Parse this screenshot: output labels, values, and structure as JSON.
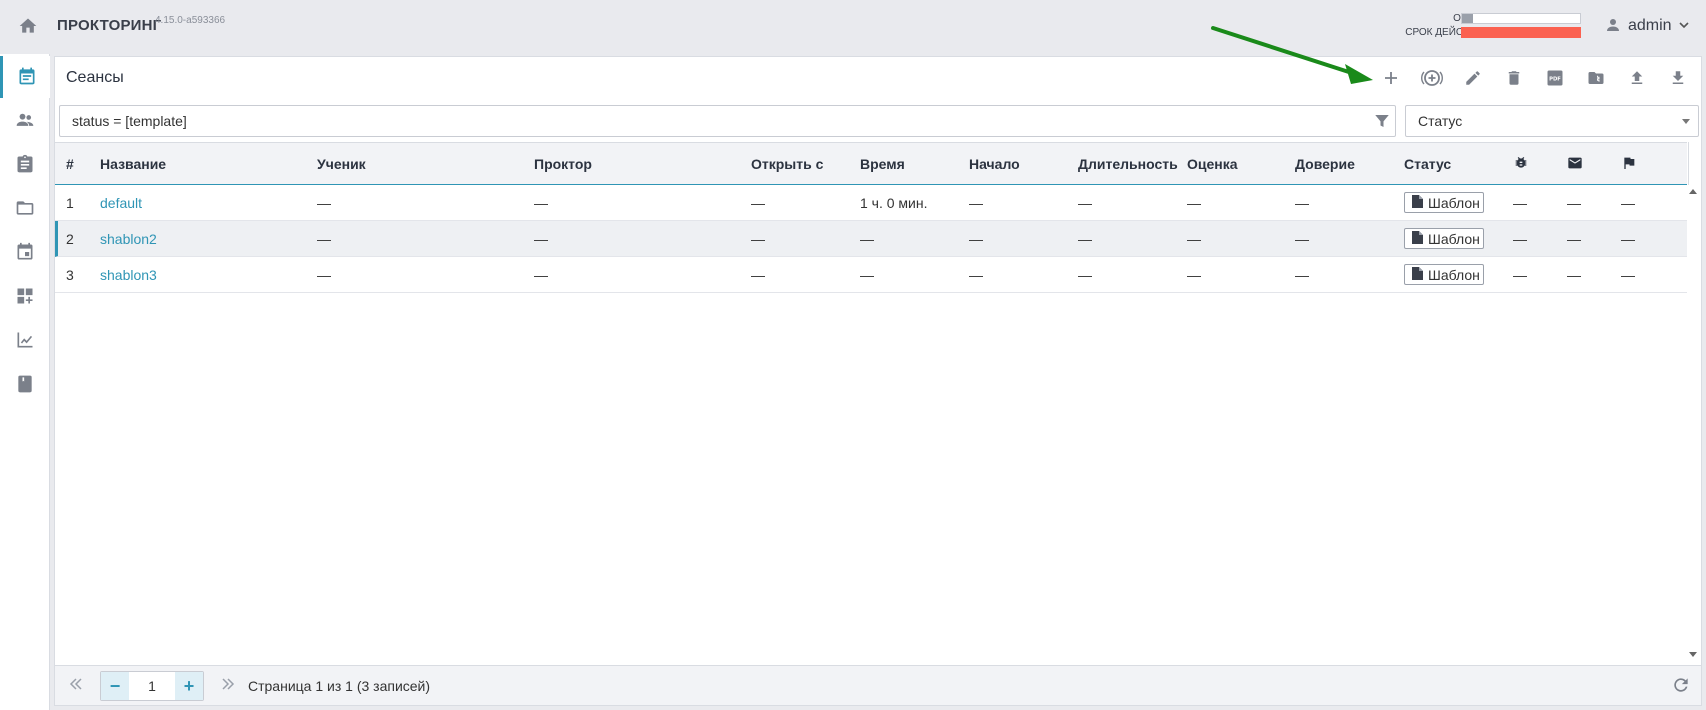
{
  "header": {
    "app_title": "ПРОКТОРИНГ",
    "app_version": "4.15.0-a593366",
    "quota_label": "ОБЪЕМ",
    "expiry_label": "СРОК ДЕЙСТВИЯ",
    "quota_fill": 0.09,
    "expiry_fill": 1.0,
    "user_name": "admin"
  },
  "sidebar": {
    "items": [
      {
        "icon": "calendar-icon",
        "active": true
      },
      {
        "icon": "users-icon",
        "active": false
      },
      {
        "icon": "clipboard-icon",
        "active": false
      },
      {
        "icon": "folder-icon",
        "active": false
      },
      {
        "icon": "event-icon",
        "active": false
      },
      {
        "icon": "dashboard-icon",
        "active": false
      },
      {
        "icon": "chart-icon",
        "active": false
      },
      {
        "icon": "book-icon",
        "active": false
      }
    ]
  },
  "panel": {
    "title": "Сеансы",
    "toolbar": [
      "add-icon",
      "add-circle-icon",
      "edit-icon",
      "delete-icon",
      "pdf-icon",
      "archive-icon",
      "upload-icon",
      "download-icon"
    ]
  },
  "filter": {
    "value": "status = [template]",
    "status_placeholder": "Статус"
  },
  "table": {
    "columns": [
      "#",
      "Название",
      "Ученик",
      "Проктор",
      "Открыть с",
      "Время",
      "Начало",
      "Длительность",
      "Оценка",
      "Доверие",
      "Статус"
    ],
    "icon_columns": [
      "bug-icon",
      "mail-icon",
      "flag-icon"
    ],
    "rows": [
      {
        "num": "1",
        "name": "default",
        "student": "—",
        "proctor": "—",
        "open_from": "—",
        "time": "1 ч. 0 мин.",
        "start": "—",
        "duration": "—",
        "score": "—",
        "trust": "—",
        "status": "Шаблон",
        "c1": "—",
        "c2": "—",
        "c3": "—"
      },
      {
        "num": "2",
        "name": "shablon2",
        "student": "—",
        "proctor": "—",
        "open_from": "—",
        "time": "—",
        "start": "—",
        "duration": "—",
        "score": "—",
        "trust": "—",
        "status": "Шаблон",
        "c1": "—",
        "c2": "—",
        "c3": "—"
      },
      {
        "num": "3",
        "name": "shablon3",
        "student": "—",
        "proctor": "—",
        "open_from": "—",
        "time": "—",
        "start": "—",
        "duration": "—",
        "score": "—",
        "trust": "—",
        "status": "Шаблон",
        "c1": "—",
        "c2": "—",
        "c3": "—"
      }
    ]
  },
  "pager": {
    "page": "1",
    "info": "Страница 1 из 1 (3 записей)"
  },
  "colors": {
    "accent": "#2f95b5",
    "expiry_bar": "#fb6150",
    "annotation_arrow": "#1a8a1a"
  }
}
